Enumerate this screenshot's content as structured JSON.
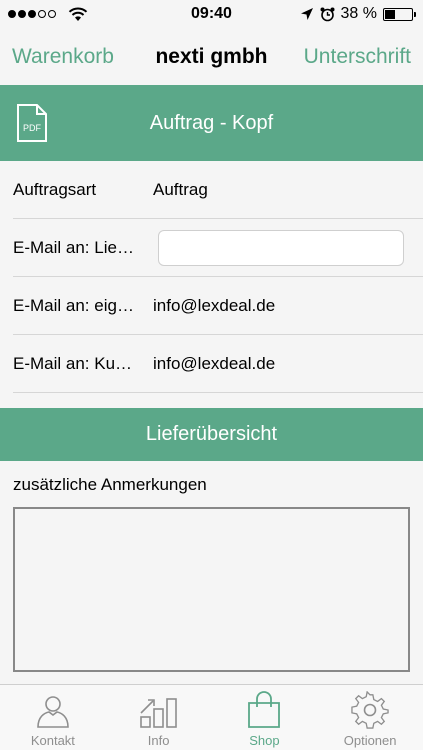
{
  "status_bar": {
    "time": "09:40",
    "battery_percent": "38 %",
    "battery_level": 0.38,
    "signal_dots_filled": 3,
    "signal_dots_total": 5
  },
  "nav": {
    "back_label": "Warenkorb",
    "title": "nexti gmbh",
    "forward_label": "Unterschrift"
  },
  "kopf": {
    "title": "Auftrag - Kopf",
    "pdf_icon_text": "PDF"
  },
  "rows": [
    {
      "label": "Auftragsart",
      "value": "Auftrag"
    },
    {
      "label": "E-Mail an: Lieferant",
      "value": "",
      "placeholder": ""
    },
    {
      "label": "E-Mail an: eigene",
      "value": "info@lexdeal.de"
    },
    {
      "label": "E-Mail an: Kunde",
      "value": "info@lexdeal.de"
    }
  ],
  "liefer": {
    "title": "Lieferübersicht"
  },
  "notes": {
    "label": "zusätzliche Anmerkungen",
    "value": ""
  },
  "tabs": [
    {
      "label": "Kontakt",
      "icon": "person-icon"
    },
    {
      "label": "Info",
      "icon": "chart-icon"
    },
    {
      "label": "Shop",
      "icon": "shopping-bag-icon",
      "active": true
    },
    {
      "label": "Optionen",
      "icon": "gear-icon"
    }
  ],
  "colors": {
    "accent": "#5ba889",
    "tab_inactive": "#8e8e8e"
  }
}
